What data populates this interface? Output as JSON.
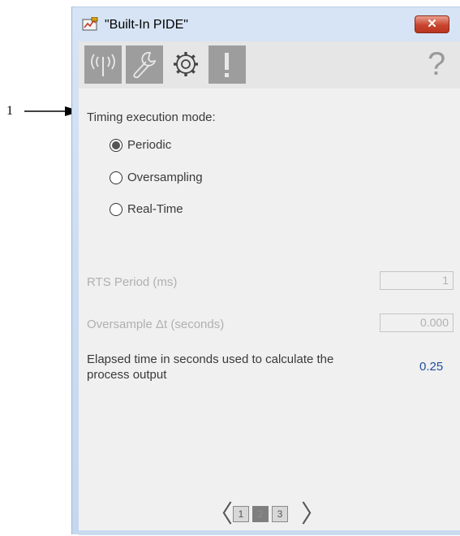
{
  "callout": {
    "number": "1"
  },
  "window": {
    "title": "\"Built-In PIDE\"",
    "close_label": "✕"
  },
  "tabs": [
    {
      "name": "operator-tab",
      "icon": "antenna-icon",
      "active": false
    },
    {
      "name": "maintenance-tab",
      "icon": "wrench-icon",
      "active": false
    },
    {
      "name": "engineering-tab",
      "icon": "gear-icon",
      "active": true
    },
    {
      "name": "diagnostics-tab",
      "icon": "exclamation-icon",
      "active": false
    }
  ],
  "help_label": "?",
  "timing": {
    "heading": "Timing execution mode:",
    "options": [
      {
        "label": "Periodic",
        "checked": true
      },
      {
        "label": "Oversampling",
        "checked": false
      },
      {
        "label": "Real-Time",
        "checked": false
      }
    ]
  },
  "rts_period": {
    "label": "RTS Period (ms)",
    "value": "1"
  },
  "oversample": {
    "label": "Oversample Δt  (seconds)",
    "value": "0.000"
  },
  "elapsed": {
    "label": "Elapsed time in seconds used to calculate the process output",
    "value": "0.25"
  },
  "pager": {
    "prev": "〈",
    "next": "〉",
    "pages": [
      "1",
      "2",
      "3"
    ],
    "current": "2"
  },
  "colors": {
    "accent_value": "#1f4e9e",
    "close_button": "#c8452f",
    "tab_inactive": "#9d9d9d"
  }
}
